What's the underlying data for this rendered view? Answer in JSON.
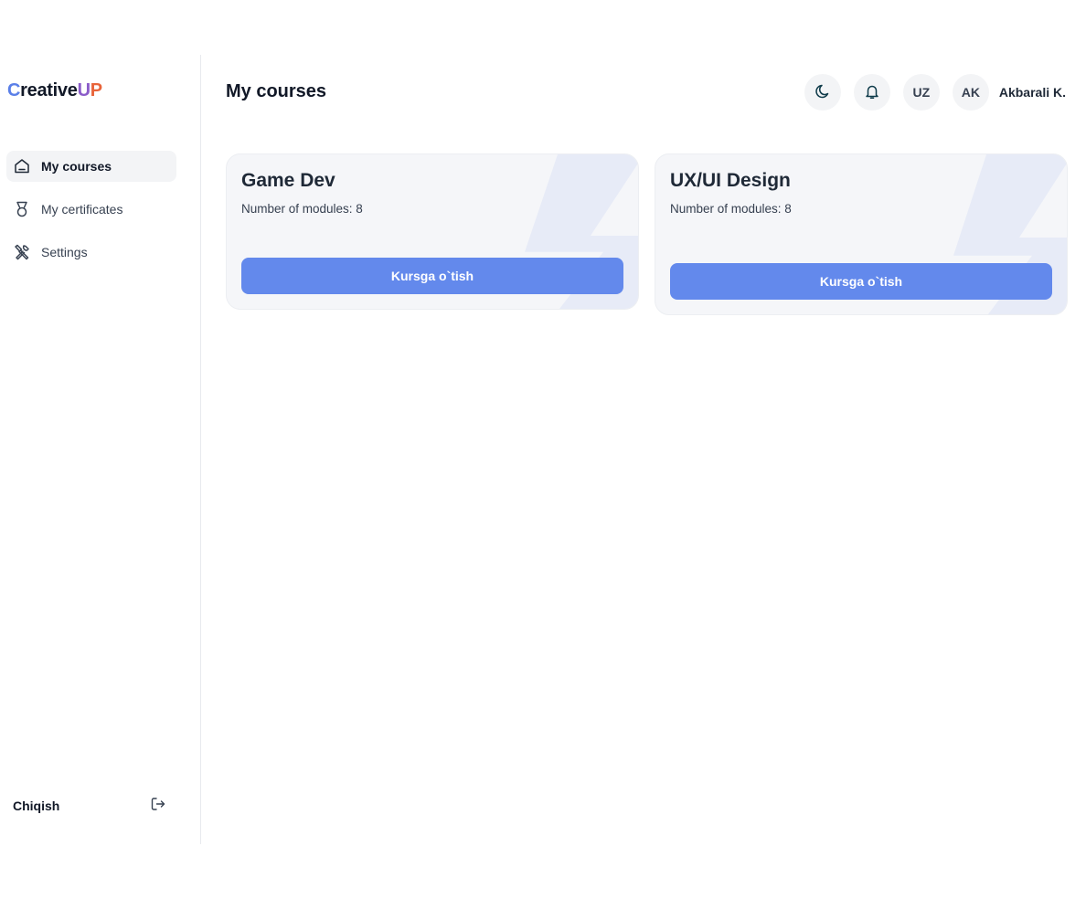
{
  "brand": {
    "part1": "C",
    "part2": "reative",
    "part3": "U",
    "part4": "P"
  },
  "sidebar": {
    "items": [
      {
        "label": "My courses",
        "icon": "home-icon",
        "active": true
      },
      {
        "label": "My certificates",
        "icon": "medal-icon",
        "active": false
      },
      {
        "label": "Settings",
        "icon": "tools-icon",
        "active": false
      }
    ],
    "logout_label": "Chiqish",
    "logout_icon": "logout-icon"
  },
  "header": {
    "title": "My courses",
    "theme_icon": "moon-icon",
    "notification_icon": "bell-icon",
    "language": "UZ",
    "avatar_initials": "AK",
    "user_name": "Akbarali K."
  },
  "courses": [
    {
      "title": "Game Dev",
      "modules_text": "Number of modules: 8",
      "button_label": "Kursga o`tish"
    },
    {
      "title": "UX/UI Design",
      "modules_text": "Number of modules: 8",
      "button_label": "Kursga o`tish"
    }
  ],
  "colors": {
    "accent": "#6389ec",
    "logo_c": "#5a7fe8",
    "logo_u": "#8b5cc9",
    "logo_p": "#e8643a",
    "card_bg": "#f5f6f9"
  }
}
